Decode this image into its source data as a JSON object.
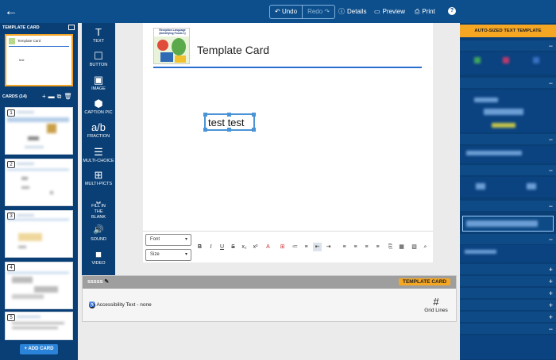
{
  "topbar": {
    "undo": "Undo",
    "redo": "Redo",
    "details": "Details",
    "preview": "Preview",
    "print": "Print",
    "help": "?"
  },
  "left": {
    "template_header": "TEMPLATE CARD",
    "template_card_title": "Template Card",
    "template_card_text": "test",
    "cards_header": "CARDS (14)",
    "cards": [
      "1",
      "2",
      "3",
      "4",
      "5"
    ],
    "add_card": "+ ADD CARD"
  },
  "tools": [
    {
      "icon": "T",
      "label": "TEXT"
    },
    {
      "icon": "☐",
      "label": "BUTTON"
    },
    {
      "icon": "▣",
      "label": "IMAGE"
    },
    {
      "icon": "⬢",
      "label": "CAPTION PIC"
    },
    {
      "icon": "a/b",
      "label": "FRACTION"
    },
    {
      "icon": "☰",
      "label": "MULTI-CHOICE"
    },
    {
      "icon": "⊞",
      "label": "MULTI-PICTS"
    },
    {
      "icon": "⎵",
      "label": "FILL IN THE BLANK"
    },
    {
      "icon": "🔊",
      "label": "SOUND"
    },
    {
      "icon": "■",
      "label": "VIDEO"
    }
  ],
  "canvas": {
    "title": "Template Card",
    "picture_caption": "Reception Language (Identifying Foods 1)",
    "textbox": "test test"
  },
  "format": {
    "font": "Font",
    "size": "Size",
    "buttons": [
      "B",
      "I",
      "U",
      "S",
      "x₂",
      "x²",
      "A",
      "⊞",
      "≔",
      "≡",
      "⇤",
      "⇥",
      "≡",
      "≡",
      "≡",
      "≡",
      "⎘",
      "▦",
      "▧",
      "⌕"
    ]
  },
  "bottom": {
    "title": "sssss",
    "tag": "TEMPLATE CARD",
    "accessibility": "Accessibility Text - none",
    "grid": "Grid Lines"
  },
  "right": {
    "header": "AUTO-SIZED TEXT TEMPLATE"
  },
  "colors": {
    "primary": "#0d4f8c",
    "panel": "#0a3f75",
    "accent": "#f5a623",
    "blue": "#2a6fd0"
  }
}
